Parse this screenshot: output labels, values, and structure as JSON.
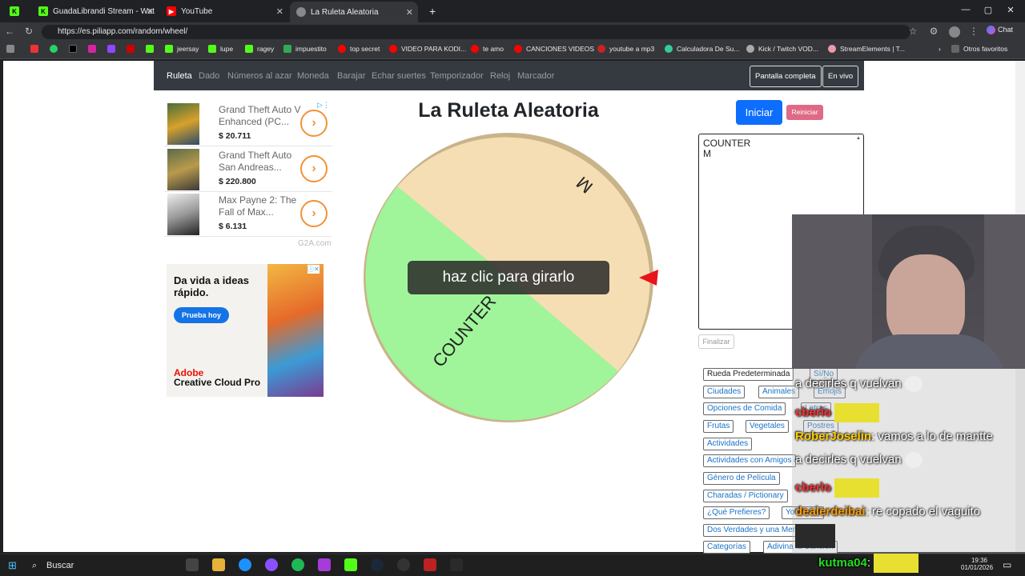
{
  "browser": {
    "tabs": [
      {
        "title": "GuadaLibrandi Stream - Wat"
      },
      {
        "title": "YouTube"
      },
      {
        "title": "La Ruleta Aleatoria"
      }
    ],
    "url": "https://es.piliapp.com/random/wheel/",
    "chat_label": "Chat",
    "bookmarks": [
      "jeersay",
      "lupe",
      "ragey",
      "impuestito",
      "top secret",
      "VIDEO PARA KODI...",
      "te amo",
      "CANCIONES VIDEOS",
      "youtube a mp3",
      "Calculadora De Su...",
      "Kick / Twitch VOD...",
      "StreamElements | T...",
      "Otros favoritos"
    ]
  },
  "site": {
    "nav": [
      "Ruleta",
      "Dado",
      "Números al azar",
      "Moneda",
      "Barajar",
      "Echar suertes",
      "Temporizador",
      "Reloj",
      "Marcador"
    ],
    "fullscreen_label": "Pantalla completa",
    "live_label": "En vivo"
  },
  "ads": {
    "products": [
      {
        "name": "Grand Theft Auto V Enhanced (PC...",
        "price": "$ 20.711"
      },
      {
        "name": "Grand Theft Auto San Andreas...",
        "price": "$ 220.800"
      },
      {
        "name": "Max Payne 2: The Fall of Max...",
        "price": "$ 6.131"
      }
    ],
    "source": "G2A.com",
    "adobe": {
      "headline": "Da vida a ideas rápido.",
      "cta": "Prueba hoy",
      "brand": "Adobe",
      "product": "Creative Cloud Pro"
    }
  },
  "wheel": {
    "title": "La Ruleta Aleatoria",
    "hint": "haz clic para girarlo",
    "segments": [
      {
        "label": "M",
        "color": "#f5deb3"
      },
      {
        "label": "COUNTER",
        "color": "#a0f59a"
      }
    ],
    "pointer_color": "#e8141b"
  },
  "controls": {
    "start": "Iniciar",
    "reset": "Reiniciar",
    "entries": "COUNTER\nM",
    "finish": "Finalizar"
  },
  "categories": [
    "Rueda Predeterminada",
    "Sí/No",
    "Ciudades",
    "Animales",
    "Emojis",
    "Opciones de Comida",
    "Letras",
    "Frutas",
    "Vegetales",
    "Postres",
    "Actividades",
    "Actividades con Amigos",
    "Género de Película",
    "Charadas / Pictionary",
    "¿Qué Prefieres?",
    "Yo Nunca",
    "Dos Verdades y una Mentira",
    "Categorías",
    "Adivina la Canción"
  ],
  "stream_chat": [
    {
      "user": "",
      "text": "a decirles q vuelvan"
    },
    {
      "user": "cberlo",
      "text": ""
    },
    {
      "user": "RoberJoselin",
      "text": "vamos a lo de mantte"
    },
    {
      "user": "",
      "text": "a decirles q vuelvan"
    },
    {
      "user": "cberlo",
      "text": ""
    },
    {
      "user": "dealerdeibai",
      "text": "re copado el vaguito"
    },
    {
      "user": "kutma04",
      "text": ""
    }
  ],
  "taskbar": {
    "search": "Buscar",
    "time": "19:36",
    "date": "01/01/2026"
  }
}
